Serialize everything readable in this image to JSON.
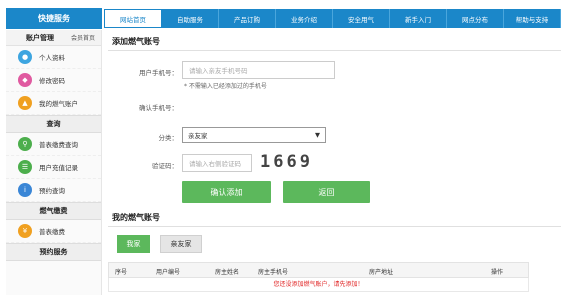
{
  "brand": "快捷服务",
  "nav": [
    "网站首页",
    "自助服务",
    "产品订购",
    "业务介绍",
    "安全用气",
    "新手入门",
    "网点分布",
    "帮助与支持"
  ],
  "sidebar": {
    "header_title": "账户管理",
    "header_link": "会员首页",
    "items_account": [
      {
        "label": "个人资料",
        "icon": "person-icon",
        "color": "#3da5e0"
      },
      {
        "label": "修改密码",
        "icon": "lock-icon",
        "color": "#e05aa0"
      },
      {
        "label": "我的燃气账户",
        "icon": "flame-icon",
        "color": "#f0a020"
      }
    ],
    "section_query": "查询",
    "items_query": [
      {
        "label": "普表缴费查询",
        "icon": "search-icon",
        "color": "#4cae4c"
      },
      {
        "label": "用户充值记录",
        "icon": "record-icon",
        "color": "#4cae4c"
      },
      {
        "label": "预约查询",
        "icon": "info-icon",
        "color": "#3a86d6"
      }
    ],
    "section_pay": "燃气缴费",
    "items_pay": [
      {
        "label": "普表缴费",
        "icon": "pay-icon",
        "color": "#f0a020"
      }
    ],
    "section_booking": "预约服务"
  },
  "form": {
    "title": "添加燃气账号",
    "phone_label": "用户手机号：",
    "phone_placeholder": "请输入亲友手机号码",
    "phone_hint": "* 不需输入已经添加过的手机号",
    "confirm_label": "确认手机号：",
    "category_label": "分类：",
    "category_value": "亲友家",
    "captcha_label": "验证码：",
    "captcha_placeholder": "请输入右侧验证码",
    "captcha_text": "1669",
    "submit": "确认添加",
    "back": "返回"
  },
  "accounts": {
    "title": "我的燃气账号",
    "tabs": [
      "我家",
      "亲友家"
    ],
    "columns": [
      "序号",
      "用户编号",
      "房主姓名",
      "房主手机号",
      "房产地址",
      "操作"
    ],
    "empty_msg": "您还没添加燃气账户，请先添加！"
  }
}
